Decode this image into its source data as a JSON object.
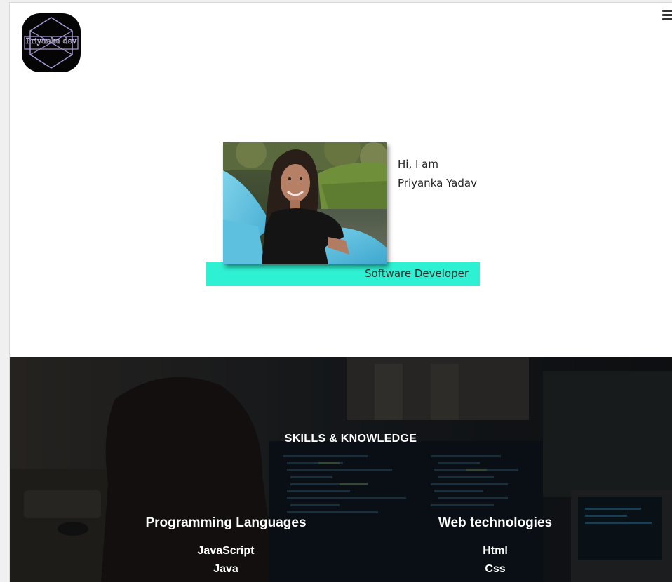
{
  "logo": {
    "text": "Priyanka dev",
    "icon": "hexagon-logo-icon"
  },
  "header": {
    "menu_icon": "hamburger-menu-icon"
  },
  "hero": {
    "greeting": "Hi, I am",
    "name": "Priyanka Yadav",
    "role": "Software Developer",
    "photo_icon": "profile-photo",
    "accent_color": "#2ef0d2"
  },
  "skills": {
    "title": "SKILLS & KNOWLEDGE",
    "columns": [
      {
        "heading": "Programming Languages",
        "items": [
          "JavaScript",
          "Java"
        ]
      },
      {
        "heading": "Web technologies",
        "items": [
          "Html",
          "Css"
        ]
      }
    ],
    "background_icon": "workspace-background-image"
  }
}
